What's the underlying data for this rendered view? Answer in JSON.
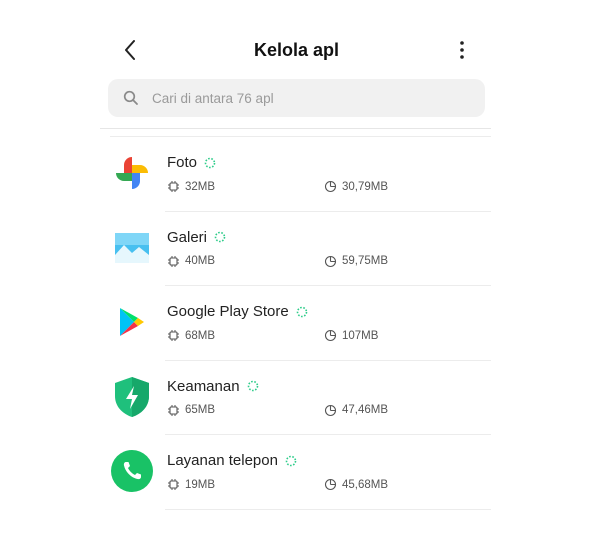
{
  "header": {
    "title": "Kelola apl",
    "back_icon": "chevron-left-icon",
    "more_icon": "more-vertical-icon"
  },
  "search": {
    "placeholder": "Cari di antara 76 apl",
    "icon": "search-icon"
  },
  "apps": [
    {
      "name": "Foto",
      "icon": "photos-pinwheel-icon",
      "status_icon": "loading-spinner-icon",
      "memory": "32MB",
      "storage": "30,79MB"
    },
    {
      "name": "Galeri",
      "icon": "gallery-landscape-icon",
      "status_icon": "loading-spinner-icon",
      "memory": "40MB",
      "storage": "59,75MB"
    },
    {
      "name": "Google Play Store",
      "icon": "play-store-icon",
      "status_icon": "loading-spinner-icon",
      "memory": "68MB",
      "storage": "107MB"
    },
    {
      "name": "Keamanan",
      "icon": "security-shield-icon",
      "status_icon": "loading-spinner-icon",
      "memory": "65MB",
      "storage": "47,46MB"
    },
    {
      "name": "Layanan telepon",
      "icon": "phone-service-icon",
      "status_icon": "loading-spinner-icon",
      "memory": "19MB",
      "storage": "45,68MB"
    }
  ],
  "colors": {
    "accent": "#2ecc8a",
    "search_bg": "#f1f1f1",
    "divider": "#ececec"
  }
}
